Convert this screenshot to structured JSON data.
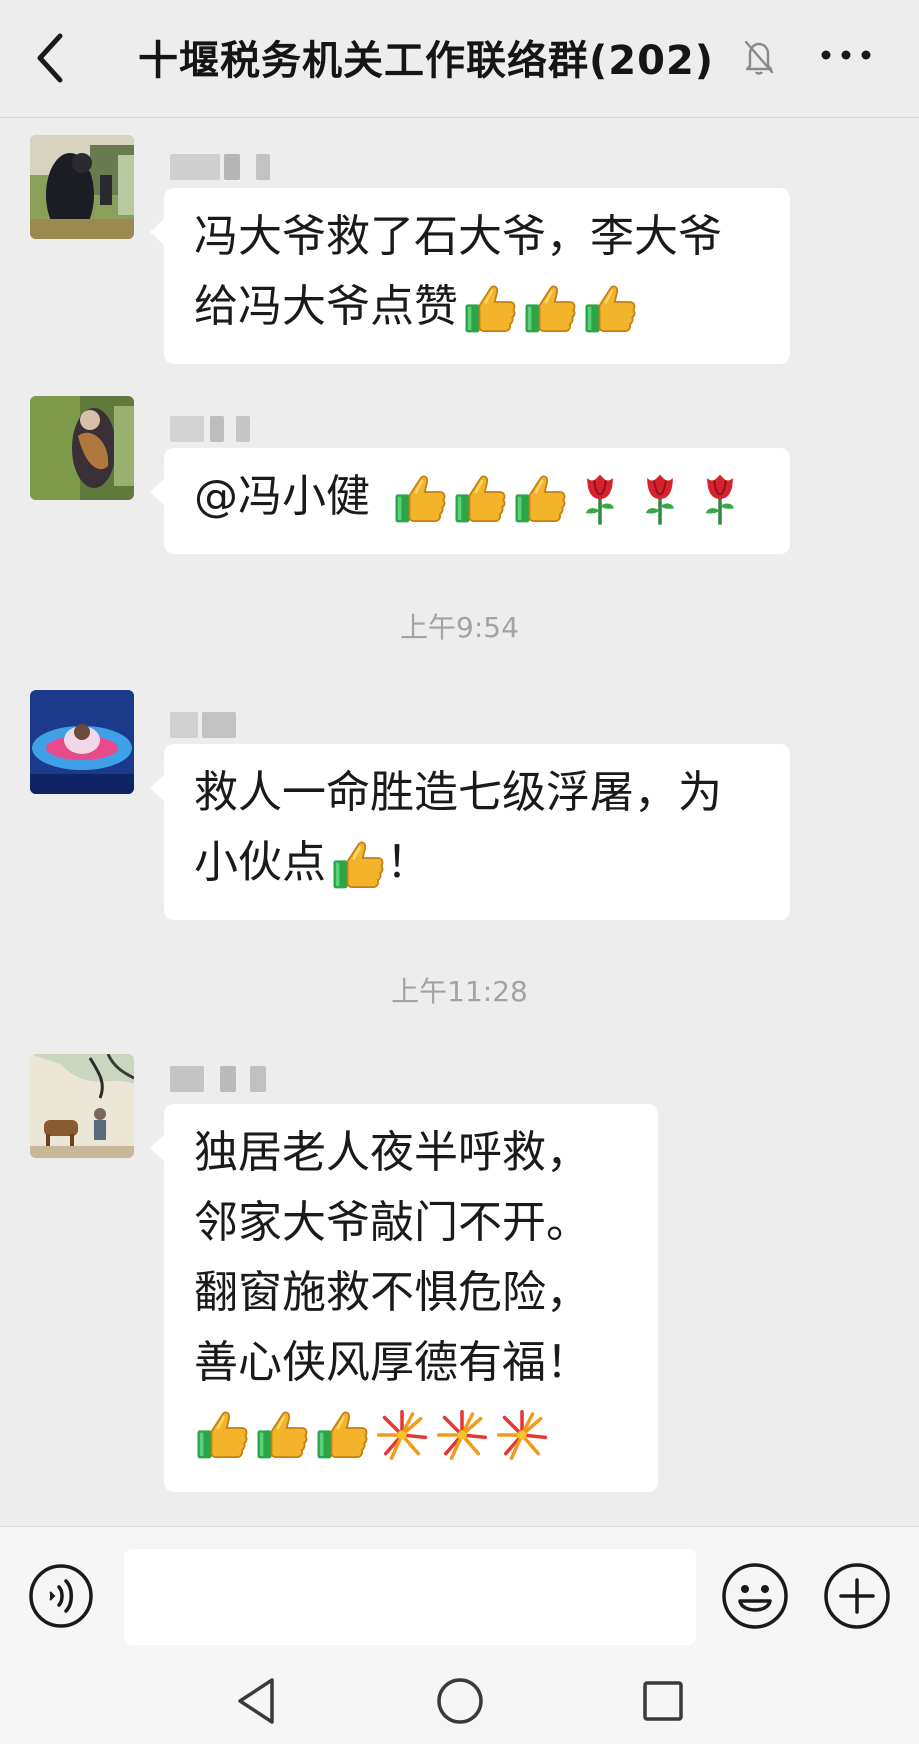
{
  "header": {
    "title": "十堰税务机关工作联络群(202)",
    "back_icon": "chevron-left-icon",
    "mute_icon": "bell-off-icon",
    "more_icon": "more-dots-icon"
  },
  "messages": [
    {
      "lines": [
        "冯大爷救了石大爷，李大爷",
        "给冯大爷点赞"
      ],
      "emojis_line2": [
        "thumbs-up",
        "thumbs-up",
        "thumbs-up"
      ]
    },
    {
      "lines": [
        "@冯小健"
      ],
      "emojis_line1": [
        "thumbs-up",
        "thumbs-up",
        "thumbs-up",
        "rose",
        "rose",
        "rose"
      ]
    },
    {
      "lines": [
        "救人一命胜造七级浮屠，为",
        "小伙点",
        "！"
      ],
      "emojis_line2": [
        "thumbs-up"
      ]
    },
    {
      "lines": [
        "独居老人夜半呼救，",
        "邻家大爷敲门不开。",
        "翻窗施救不惧危险，",
        "善心侠风厚德有福！"
      ],
      "emojis_line5": [
        "thumbs-up",
        "thumbs-up",
        "thumbs-up",
        "fireworks",
        "fireworks",
        "fireworks"
      ]
    }
  ],
  "timestamps": [
    "上午9:54",
    "上午11:28"
  ],
  "input_bar": {
    "voice_icon": "voice-icon",
    "emoji_icon": "smiley-icon",
    "plus_icon": "plus-icon",
    "text_value": ""
  },
  "nav_bar": {
    "back_icon": "triangle-back-icon",
    "home_icon": "circle-home-icon",
    "recent_icon": "square-recent-icon"
  },
  "colors": {
    "background": "#ededed",
    "bubble": "#ffffff",
    "timestamp": "#a3a3a3",
    "title": "#151515"
  }
}
